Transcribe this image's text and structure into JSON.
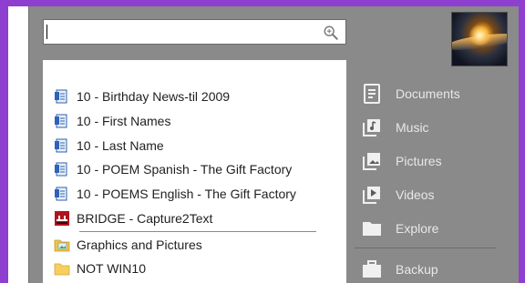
{
  "search": {
    "placeholder": ""
  },
  "files": [
    {
      "label": "10 - Birthday News-til 2009",
      "icon": "document-icon"
    },
    {
      "label": "10 - First Names",
      "icon": "document-icon"
    },
    {
      "label": "10 - Last Name",
      "icon": "document-icon"
    },
    {
      "label": "10 - POEM Spanish - The Gift Factory",
      "icon": "document-icon"
    },
    {
      "label": "10 - POEMS English - The Gift Factory",
      "icon": "document-icon"
    },
    {
      "label": "BRIDGE - Capture2Text",
      "icon": "app-icon"
    },
    {
      "label": "Graphics and Pictures",
      "icon": "folder-image-icon"
    },
    {
      "label": "NOT WIN10",
      "icon": "folder-icon"
    }
  ],
  "places": [
    {
      "label": "Documents",
      "icon": "documents-icon"
    },
    {
      "label": "Music",
      "icon": "music-icon"
    },
    {
      "label": "Pictures",
      "icon": "pictures-icon"
    },
    {
      "label": "Videos",
      "icon": "videos-icon"
    },
    {
      "label": "Explore",
      "icon": "folder-icon"
    },
    {
      "label": "Backup",
      "icon": "briefcase-icon"
    }
  ],
  "colors": {
    "frame": "#8f3fcf",
    "panel": "#8a8a8a",
    "sidebar_text": "#e8e8e8"
  }
}
